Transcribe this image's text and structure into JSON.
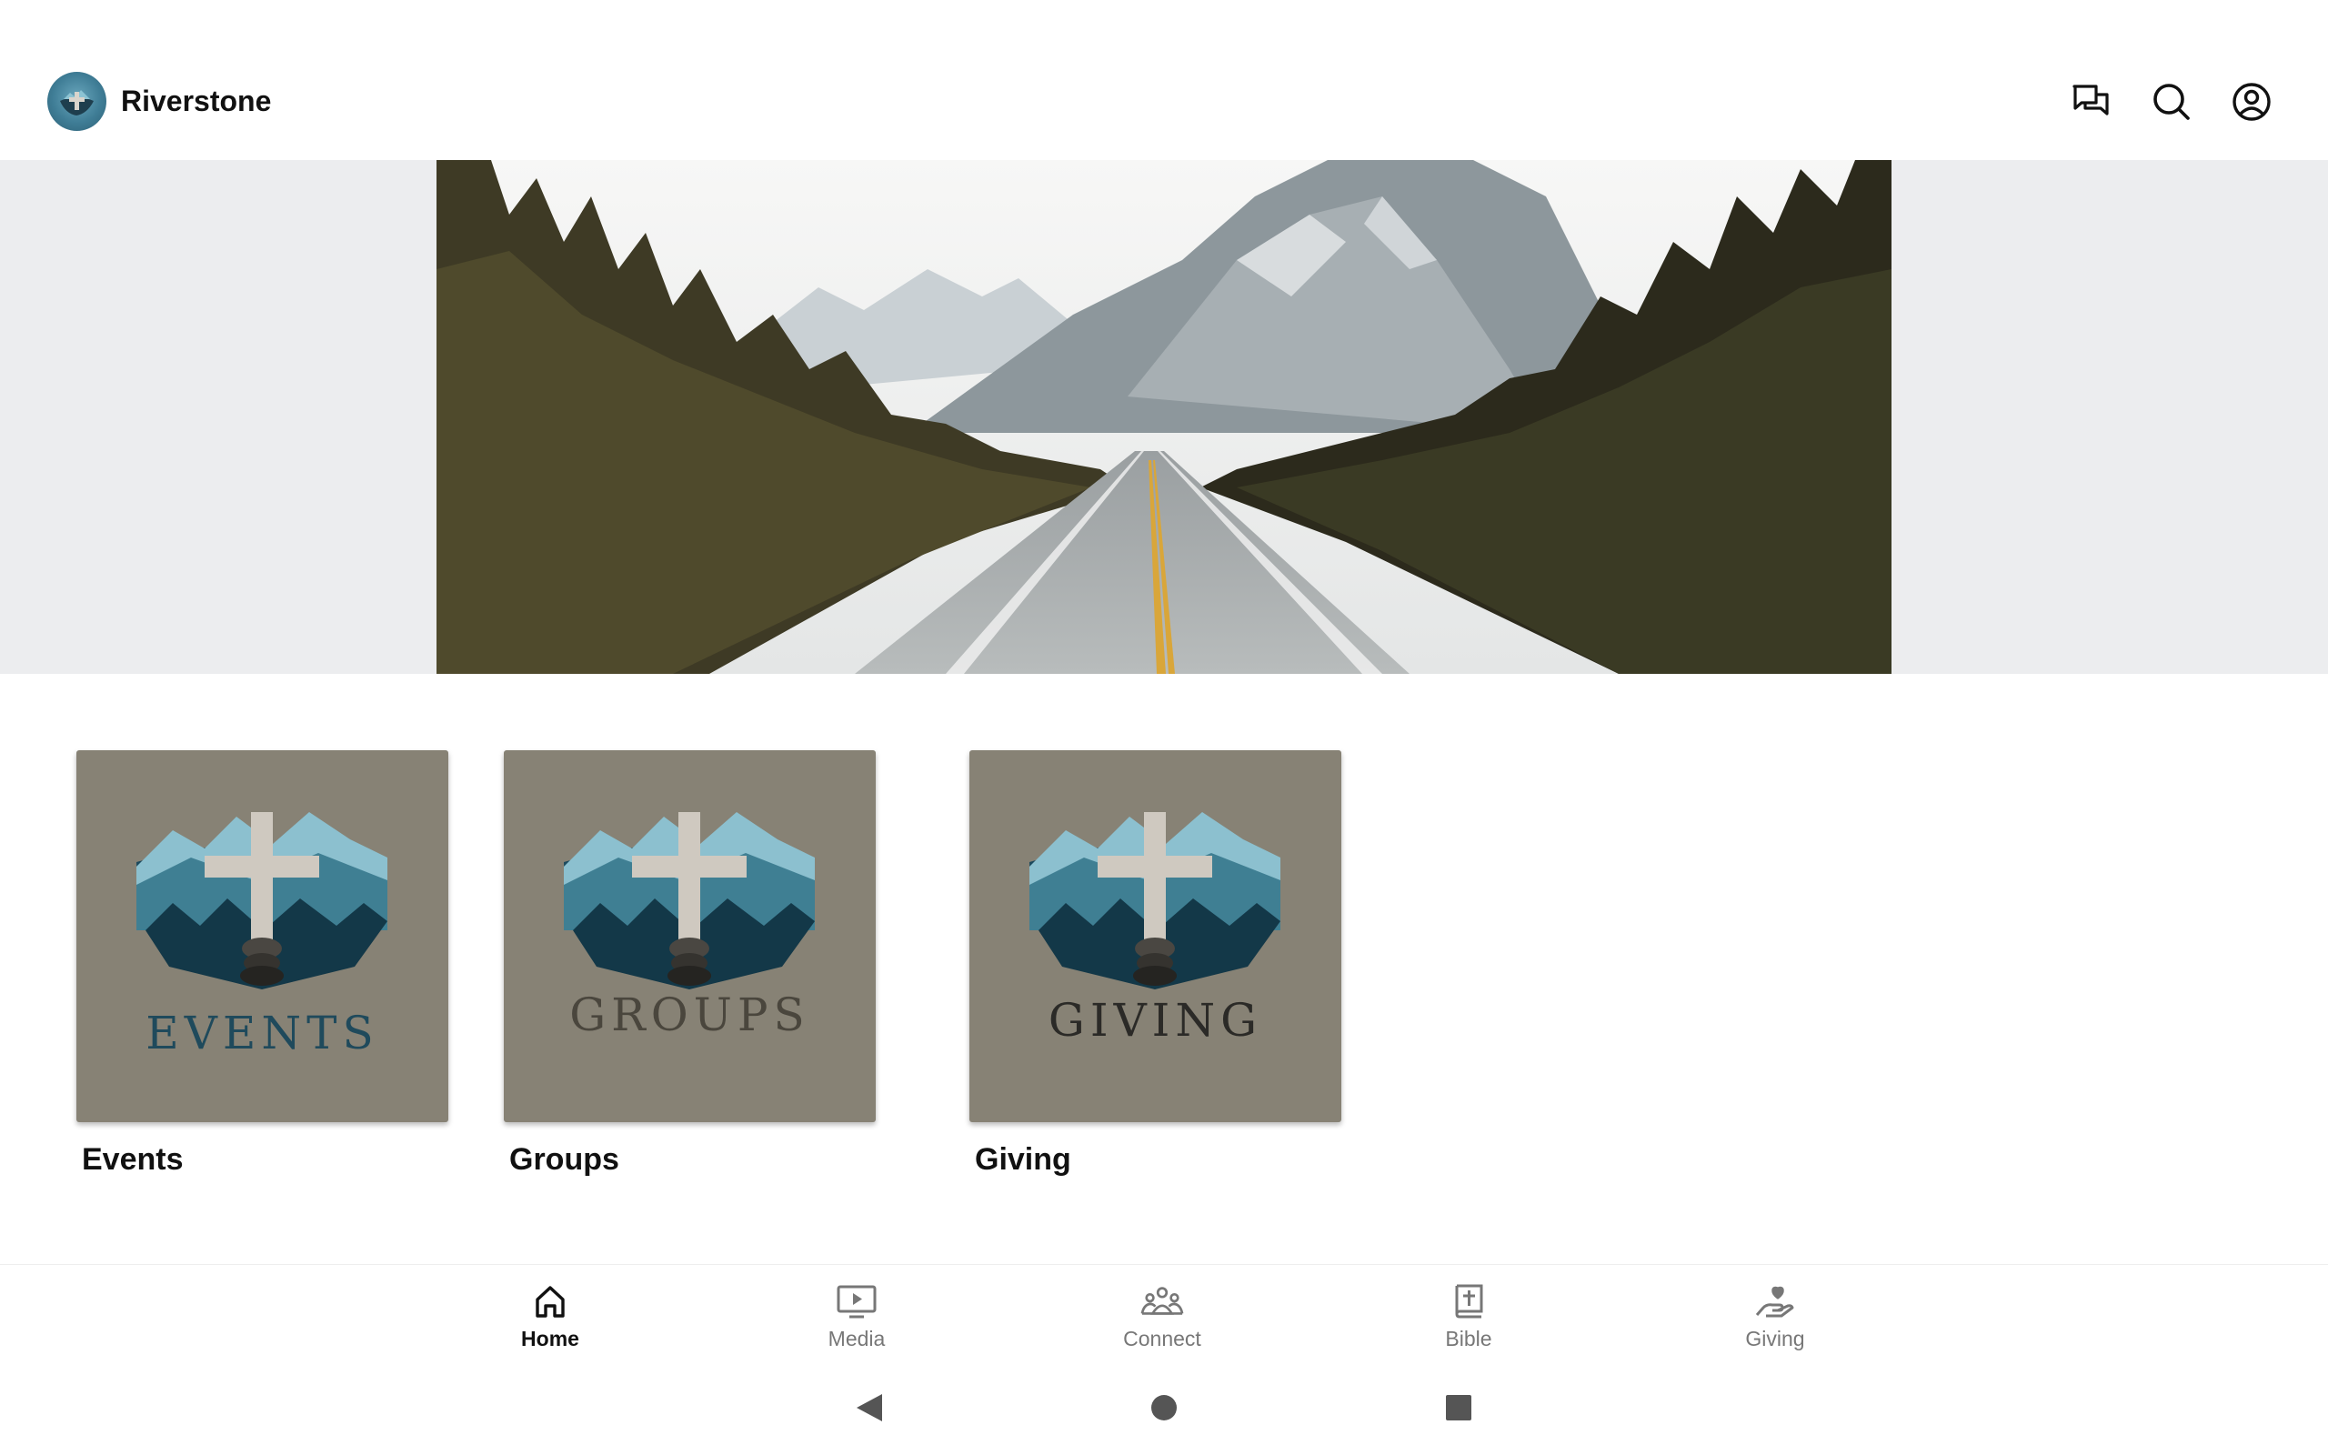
{
  "app": {
    "name": "Riverstone"
  },
  "header": {
    "icons": [
      "chat-icon",
      "search-icon",
      "account-icon"
    ]
  },
  "tiles": [
    {
      "card_text": "EVENTS",
      "label": "Events",
      "text_color": "#1f4a5c"
    },
    {
      "card_text": "GROUPS",
      "label": "Groups",
      "text_color": "#4a463d"
    },
    {
      "card_text": "GIVING",
      "label": "Giving",
      "text_color": "#2b2a27"
    }
  ],
  "bottom_nav": {
    "items": [
      {
        "label": "Home",
        "icon": "home-icon",
        "active": true
      },
      {
        "label": "Media",
        "icon": "media-icon",
        "active": false
      },
      {
        "label": "Connect",
        "icon": "connect-icon",
        "active": false
      },
      {
        "label": "Bible",
        "icon": "bible-icon",
        "active": false
      },
      {
        "label": "Giving",
        "icon": "giving-icon",
        "active": false
      }
    ]
  },
  "system_nav": {
    "icons": [
      "back-icon",
      "home-circle-icon",
      "recents-icon"
    ]
  },
  "colors": {
    "tile_background": "#878275",
    "hero_band": "#ecedef",
    "active_nav": "#111111",
    "inactive_nav": "#777777"
  }
}
